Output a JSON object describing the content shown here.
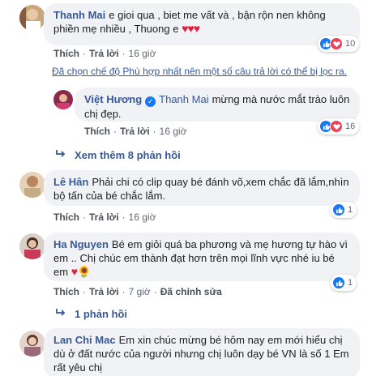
{
  "comments": [
    {
      "author": "Thanh Mai",
      "text": "e gioi qua , biet me vất và , bận rộn nen không phiền mẹ nhiều , Thuong e",
      "emoji": "♥♥♥",
      "like_label": "Thích",
      "reply_label": "Trả lời",
      "time": "16 giờ",
      "reaction_count": "10"
    },
    {
      "author": "Việt Hương",
      "mention": "Thanh Mai",
      "text": "mừng mà nước mắt trào luôn chị đẹp.",
      "like_label": "Thích",
      "reply_label": "Trả lời",
      "time": "16 giờ",
      "reaction_count": "16"
    },
    {
      "author": "Lê Hân",
      "text": "Phải chi có clip quay bé đánh võ,xem chắc đã lắm,nhìn bộ tấn của bé chắc lắm.",
      "like_label": "Thích",
      "reply_label": "Trả lời",
      "time": "16 giờ",
      "reaction_count": "1"
    },
    {
      "author": "Ha Nguyen",
      "text": "Bé em giỏi quá ba phương và mẹ hương tự hào vì em .. Chị chúc em thành đạt hơn trên mọi lĩnh vực nhé iu bé em",
      "emoji": "♥🌻",
      "like_label": "Thích",
      "reply_label": "Trả lời",
      "time": "7 giờ",
      "edited_label": "Đã chỉnh sửa",
      "reaction_count": "1"
    },
    {
      "author": "Lan Chi Mac",
      "text": "Em xin chúc mừng bé hôm nay em mới hiểu chị dù ở đất nước của người nhưng chị luôn dạy bé VN là số 1 Em rất yêu chị"
    }
  ],
  "filter_notice": "Đã chọn chế độ Phù hợp nhất nên một số câu trả lời có thể bị lọc ra.",
  "see_more_replies": "Xem thêm 8 phản hồi",
  "one_reply": "1 phản hồi",
  "colors": {
    "link": "#385898",
    "bubble": "#f0f2f5",
    "like": "#1877f2",
    "love": "#f33e58"
  }
}
